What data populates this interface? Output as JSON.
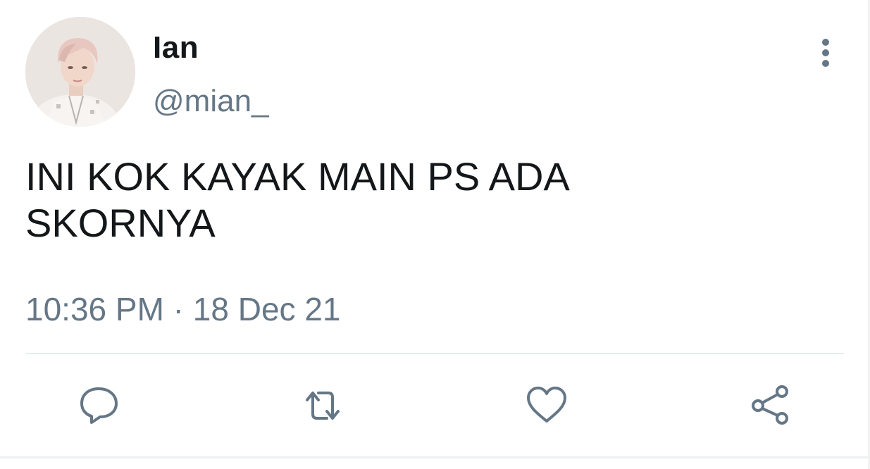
{
  "tweet": {
    "author": {
      "display_name": "Ian",
      "handle": "@mian_"
    },
    "text": "INI KOK KAYAK MAIN PS ADA\nSKORNYA",
    "time": "10:36 PM",
    "separator": " · ",
    "date": "18 Dec 21"
  },
  "icons": {
    "more": "more-vertical-icon",
    "reply": "reply-icon",
    "retweet": "retweet-icon",
    "like": "heart-icon",
    "share": "share-icon"
  },
  "colors": {
    "text": "#14171a",
    "secondary": "#657786",
    "divider": "#e6ecf0"
  }
}
